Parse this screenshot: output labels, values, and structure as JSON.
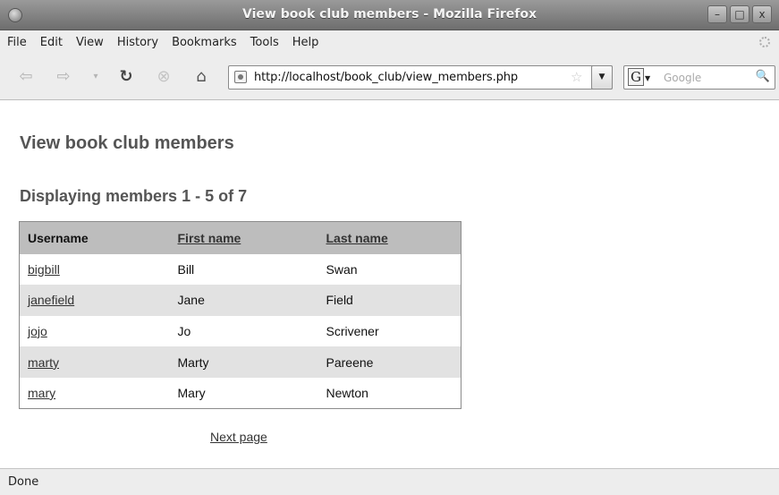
{
  "window": {
    "title": "View book club members - Mozilla Firefox",
    "minimize": "–",
    "maximize": "□",
    "close": "x"
  },
  "menu": {
    "items": [
      "File",
      "Edit",
      "View",
      "History",
      "Bookmarks",
      "Tools",
      "Help"
    ]
  },
  "nav": {
    "back_icon": "back-arrow-icon",
    "forward_icon": "forward-arrow-icon",
    "dropdown_icon": "history-dropdown-icon",
    "reload_icon": "reload-icon",
    "stop_icon": "stop-icon",
    "home_icon": "home-icon",
    "url": "http://localhost/book_club/view_members.php",
    "search_placeholder": "Google",
    "search_engine": "G"
  },
  "page": {
    "heading": "View book club members",
    "subheading": "Displaying members 1 - 5 of 7",
    "table": {
      "headers": [
        "Username",
        "First name",
        "Last name"
      ],
      "rows": [
        [
          "bigbill",
          "Bill",
          "Swan"
        ],
        [
          "janefield",
          "Jane",
          "Field"
        ],
        [
          "jojo",
          "Jo",
          "Scrivener"
        ],
        [
          "marty",
          "Marty",
          "Pareene"
        ],
        [
          "mary",
          "Mary",
          "Newton"
        ]
      ]
    },
    "next_link": "Next page"
  },
  "status": {
    "text": "Done"
  }
}
